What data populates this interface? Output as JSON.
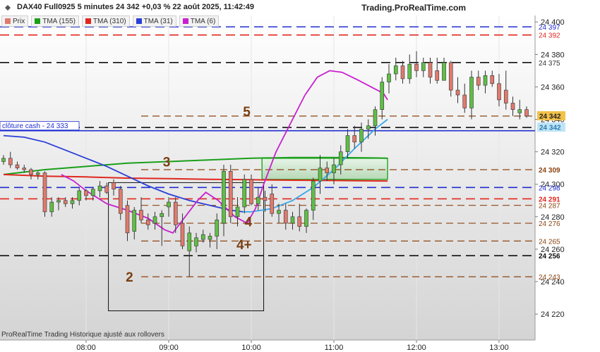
{
  "header": {
    "title": "DAX40 Full0925 5 minutes 24 342 +0,03 % 22 août 2025, 11:42:49",
    "brand": "Trading.ProRealTime.com"
  },
  "legend": [
    {
      "label": "Prix",
      "color": "#e07a6e"
    },
    {
      "label": "TMA (155)",
      "color": "#1a9f1a"
    },
    {
      "label": "TMA (310)",
      "color": "#e0281e"
    },
    {
      "label": "TMA (31)",
      "color": "#2b3fd6"
    },
    {
      "label": "TMA (6)",
      "color": "#c91fd0"
    }
  ],
  "footer": "ProRealTime Trading  Historique ajusté aux rollovers",
  "chart_data": {
    "type": "candlestick",
    "timeframe": "5 minutes",
    "ylim": [
      24204,
      24404
    ],
    "y_ticks": [
      24220,
      24240,
      24260,
      24280,
      24300,
      24320,
      24340,
      24360,
      24380,
      24400
    ],
    "x_ticks": [
      {
        "label": "08:00",
        "t": 8.0
      },
      {
        "label": "09:00",
        "t": 9.0
      },
      {
        "label": "10:00",
        "t": 10.0
      },
      {
        "label": "11:00",
        "t": 11.0
      },
      {
        "label": "12:00",
        "t": 12.0
      },
      {
        "label": "13:00",
        "t": 13.0
      }
    ],
    "candles_start": 7.0,
    "candle_minutes": 5,
    "candles": [
      [
        24314,
        24318,
        24312,
        24316
      ],
      [
        24316,
        24320,
        24310,
        24312
      ],
      [
        24312,
        24314,
        24309,
        24310
      ],
      [
        24310,
        24312,
        24307,
        24309
      ],
      [
        24309,
        24310,
        24303,
        24306
      ],
      [
        24306,
        24308,
        24303,
        24307
      ],
      [
        24307,
        24308,
        24280,
        24283
      ],
      [
        24283,
        24292,
        24280,
        24289
      ],
      [
        24289,
        24292,
        24284,
        24290
      ],
      [
        24290,
        24292,
        24286,
        24288
      ],
      [
        24288,
        24292,
        24285,
        24290
      ],
      [
        24290,
        24298,
        24287,
        24296
      ],
      [
        24296,
        24297,
        24290,
        24293
      ],
      [
        24293,
        24298,
        24290,
        24297
      ],
      [
        24296,
        24302,
        24292,
        24299
      ],
      [
        24299,
        24301,
        24294,
        24295
      ],
      [
        24301,
        24303,
        24293,
        24297
      ],
      [
        24297,
        24299,
        24278,
        24282
      ],
      [
        24287,
        24290,
        24265,
        24270
      ],
      [
        24271,
        24286,
        24266,
        24284
      ],
      [
        24284,
        24292,
        24276,
        24278
      ],
      [
        24278,
        24282,
        24272,
        24275
      ],
      [
        24276,
        24283,
        24272,
        24280
      ],
      [
        24280,
        24284,
        24262,
        24282
      ],
      [
        24286,
        24292,
        24280,
        24289
      ],
      [
        24289,
        24292,
        24270,
        24275
      ],
      [
        24276,
        24282,
        24260,
        24262
      ],
      [
        24259,
        24274,
        24243,
        24270
      ],
      [
        24262,
        24270,
        24258,
        24267
      ],
      [
        24266,
        24272,
        24264,
        24269
      ],
      [
        24266,
        24270,
        24261,
        24268
      ],
      [
        24268,
        24282,
        24260,
        24278
      ],
      [
        24276,
        24312,
        24268,
        24308
      ],
      [
        24308,
        24312,
        24276,
        24280
      ],
      [
        24280,
        24292,
        24274,
        24286
      ],
      [
        24286,
        24306,
        24282,
        24303
      ],
      [
        24303,
        24306,
        24287,
        24288
      ],
      [
        24288,
        24298,
        24284,
        24292
      ],
      [
        24292,
        24296,
        24283,
        24290
      ],
      [
        24294,
        24300,
        24280,
        24282
      ],
      [
        24282,
        24288,
        24276,
        24284
      ],
      [
        24284,
        24288,
        24272,
        24276
      ],
      [
        24276,
        24283,
        24272,
        24280
      ],
      [
        24280,
        24288,
        24271,
        24274
      ],
      [
        24274,
        24285,
        24270,
        24284
      ],
      [
        24284,
        24304,
        24278,
        24302
      ],
      [
        24302,
        24318,
        24294,
        24310
      ],
      [
        24310,
        24314,
        24302,
        24307
      ],
      [
        24307,
        24316,
        24300,
        24312
      ],
      [
        24312,
        24324,
        24306,
        24320
      ],
      [
        24320,
        24334,
        24316,
        24330
      ],
      [
        24330,
        24336,
        24322,
        24326
      ],
      [
        24326,
        24338,
        24320,
        24334
      ],
      [
        24334,
        24340,
        24328,
        24336
      ],
      [
        24336,
        24348,
        24330,
        24346
      ],
      [
        24346,
        24366,
        24340,
        24363
      ],
      [
        24363,
        24374,
        24356,
        24368
      ],
      [
        24368,
        24378,
        24364,
        24373
      ],
      [
        24373,
        24376,
        24362,
        24365
      ],
      [
        24365,
        24380,
        24362,
        24374
      ],
      [
        24374,
        24382,
        24366,
        24370
      ],
      [
        24370,
        24378,
        24366,
        24375
      ],
      [
        24375,
        24378,
        24362,
        24366
      ],
      [
        24370,
        24378,
        24362,
        24364
      ],
      [
        24364,
        24378,
        24364,
        24375
      ],
      [
        24375,
        24376,
        24354,
        24358
      ],
      [
        24358,
        24366,
        24350,
        24355
      ],
      [
        24355,
        24362,
        24344,
        24347
      ],
      [
        24347,
        24370,
        24340,
        24366
      ],
      [
        24366,
        24370,
        24358,
        24361
      ],
      [
        24361,
        24370,
        24356,
        24367
      ],
      [
        24367,
        24370,
        24360,
        24362
      ],
      [
        24362,
        24368,
        24348,
        24352
      ],
      [
        24358,
        24370,
        24346,
        24350
      ],
      [
        24350,
        24354,
        24342,
        24346
      ],
      [
        24344,
        24352,
        24340,
        24346
      ],
      [
        24346,
        24348,
        24341,
        24342
      ]
    ],
    "moving_averages": [
      {
        "label": "TMA (155)",
        "color": "#1a9f1a",
        "points": [
          [
            7.0,
            24306
          ],
          [
            7.5,
            24309
          ],
          [
            8.0,
            24311
          ],
          [
            8.5,
            24313
          ],
          [
            9.0,
            24314
          ],
          [
            9.5,
            24315
          ],
          [
            10.0,
            24316
          ],
          [
            10.5,
            24316.5
          ],
          [
            11.0,
            24316.5
          ],
          [
            11.5,
            24316.2
          ],
          [
            11.65,
            24316
          ]
        ]
      },
      {
        "label": "TMA (310)",
        "color": "#e0281e",
        "points": [
          [
            7.0,
            24306
          ],
          [
            7.5,
            24305
          ],
          [
            8.0,
            24304.5
          ],
          [
            8.5,
            24303.8
          ],
          [
            9.0,
            24303.5
          ],
          [
            9.5,
            24303
          ],
          [
            10.0,
            24302.8
          ],
          [
            10.5,
            24302.5
          ],
          [
            11.0,
            24302.3
          ],
          [
            11.65,
            24302
          ]
        ]
      },
      {
        "label": "TMA (31)",
        "color": "#2b3fd6",
        "points": [
          [
            7.0,
            24330
          ],
          [
            7.25,
            24329
          ],
          [
            7.5,
            24326
          ],
          [
            7.75,
            24321
          ],
          [
            8.0,
            24316
          ],
          [
            8.25,
            24311
          ],
          [
            8.5,
            24305
          ],
          [
            8.75,
            24299
          ],
          [
            9.0,
            24294
          ],
          [
            9.25,
            24290
          ],
          [
            9.5,
            24287
          ],
          [
            9.75,
            24284
          ],
          [
            9.9,
            24283
          ]
        ]
      },
      {
        "label": "TMA (31)",
        "color": "#3aa7e8",
        "points": [
          [
            9.9,
            24283
          ],
          [
            10.0,
            24283
          ],
          [
            10.25,
            24285
          ],
          [
            10.5,
            24290
          ],
          [
            10.75,
            24298
          ],
          [
            11.0,
            24309
          ],
          [
            11.25,
            24322
          ],
          [
            11.5,
            24334
          ],
          [
            11.65,
            24340
          ]
        ]
      },
      {
        "label": "TMA (6)",
        "color": "#c91fd0",
        "points": [
          [
            7.7,
            24306
          ],
          [
            7.85,
            24302
          ],
          [
            8.0,
            24296
          ],
          [
            8.25,
            24288
          ],
          [
            8.5,
            24284
          ],
          [
            8.75,
            24279
          ],
          [
            8.95,
            24272
          ],
          [
            9.05,
            24270
          ],
          [
            9.2,
            24280
          ],
          [
            9.35,
            24290
          ],
          [
            9.45,
            24295
          ],
          [
            9.6,
            24290
          ],
          [
            9.8,
            24280
          ],
          [
            9.95,
            24276
          ],
          [
            10.05,
            24285
          ],
          [
            10.15,
            24300
          ],
          [
            10.3,
            24320
          ],
          [
            10.5,
            24340
          ],
          [
            10.65,
            24355
          ],
          [
            10.8,
            24366
          ],
          [
            10.95,
            24370
          ],
          [
            11.1,
            24369
          ],
          [
            11.3,
            24364
          ],
          [
            11.45,
            24360
          ],
          [
            11.6,
            24356
          ],
          [
            11.65,
            24352
          ]
        ]
      }
    ],
    "levels": [
      {
        "value": 24397,
        "color": "#1f2ed2",
        "style": "dash",
        "label": "24 397",
        "label_color": "#1f2ed2"
      },
      {
        "value": 24392,
        "color": "#e0281e",
        "style": "dash",
        "label": "24 392",
        "label_color": "#e0281e"
      },
      {
        "value": 24375,
        "color": "#111111",
        "style": "dash",
        "label": "24 375",
        "label_color": "#333333"
      },
      {
        "value": 24342,
        "color": "#8b4513",
        "style": "dash",
        "label": "24 342",
        "label_color": "#8b4513"
      },
      {
        "value": 24335,
        "color": "#111111",
        "style": "dash",
        "label": "24 335",
        "label_color": "#333333"
      },
      {
        "value": 24309,
        "color": "#8b4513",
        "style": "dash",
        "label": "24 309",
        "label_color": "#8b4513",
        "bold": true
      },
      {
        "value": 24298,
        "color": "#1f2ed2",
        "style": "dash",
        "label": "24 298",
        "label_color": "#1f2ed2"
      },
      {
        "value": 24291,
        "color": "#e0281e",
        "style": "dash",
        "label": "24 291",
        "label_color": "#e0281e",
        "bold": true
      },
      {
        "value": 24287,
        "color": "#8b4513",
        "style": "dash",
        "label": "24 287",
        "label_color": "#8b4513"
      },
      {
        "value": 24276,
        "color": "#8b4513",
        "style": "dash",
        "label": "24 276",
        "label_color": "#8b4513"
      },
      {
        "value": 24265,
        "color": "#8b4513",
        "style": "dash",
        "label": "24 265",
        "label_color": "#8b4513"
      },
      {
        "value": 24256,
        "color": "#111111",
        "style": "dash",
        "label": "24 256",
        "label_color": "#111111",
        "bold": true
      },
      {
        "value": 24243,
        "color": "#8b4513",
        "style": "dash",
        "label": "24 243",
        "label_color": "#8b4513"
      }
    ],
    "close_line": {
      "value": 24333,
      "label": "clôture cash -  24 333",
      "color": "#1f2ed2"
    },
    "zone": {
      "from": 24303,
      "to": 24316,
      "t_start": 10.13,
      "t_end": 11.65
    },
    "box": {
      "t_start": 8.27,
      "t_end": 10.15,
      "y_top": 24301,
      "y_bottom": 24222
    },
    "wave_labels": [
      {
        "text": "2",
        "t": 8.48,
        "y": 24240
      },
      {
        "text": "3",
        "t": 8.93,
        "y": 24311
      },
      {
        "text": "4",
        "t": 9.92,
        "y": 24274
      },
      {
        "text": "4+",
        "t": 9.82,
        "y": 24260
      },
      {
        "text": "5",
        "t": 9.9,
        "y": 24342
      }
    ],
    "price_tags": [
      {
        "label": "24 342",
        "y": 24342,
        "bg": "#f2c14a",
        "fg": "#222222"
      },
      {
        "label": "24 342",
        "y": 24335,
        "bg": "#bfe4f7",
        "fg": "#2b7bb0"
      }
    ],
    "colors": {
      "up": "#5fbf45",
      "down": "#e07a6e",
      "zone": "#2ea82e"
    }
  }
}
